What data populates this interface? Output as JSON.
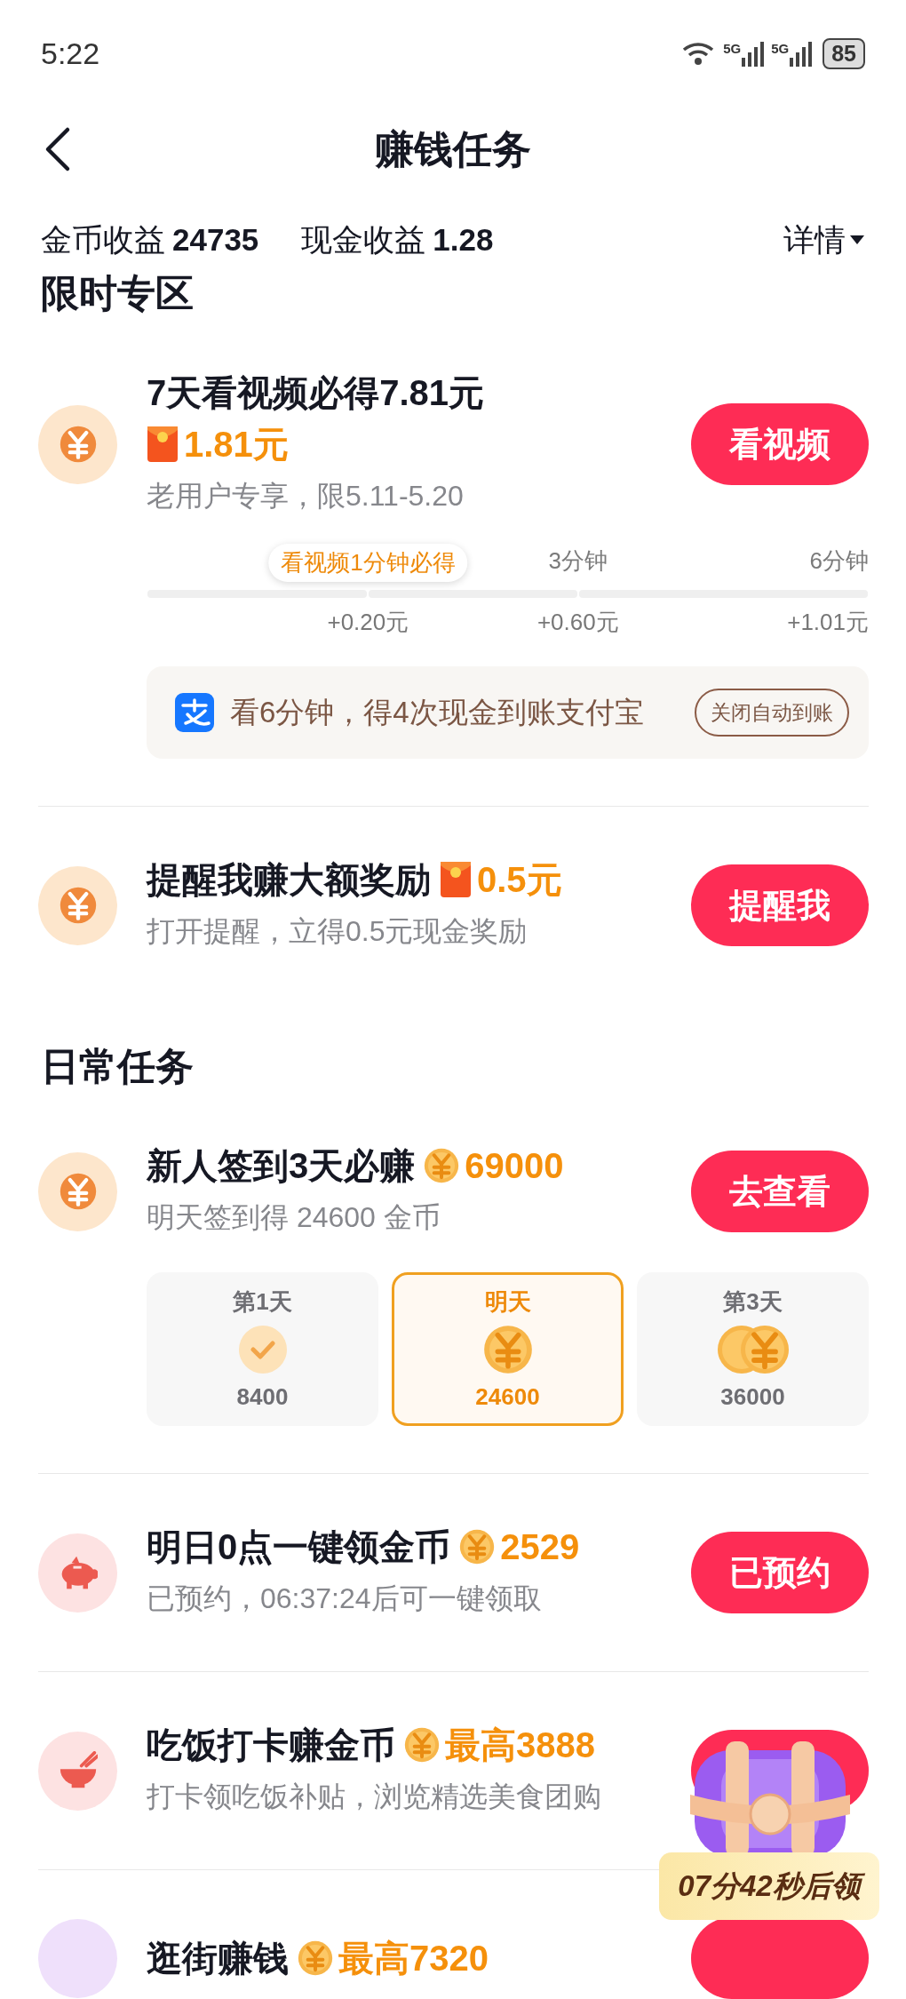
{
  "status_bar": {
    "time": "5:22",
    "network_1": "5G",
    "network_2": "5G",
    "battery": "85"
  },
  "header": {
    "title": "赚钱任务"
  },
  "stats": {
    "coin_label": "金币收益",
    "coin_value": "24735",
    "cash_label": "现金收益",
    "cash_value": "1.28",
    "details": "详情"
  },
  "sections": [
    {
      "title": "限时专区",
      "tasks": [
        {
          "kind": "yen",
          "title": "7天看视频必得7.81元",
          "reward": {
            "kind": "packet",
            "text": "1.81元"
          },
          "subtitle": "老用户专享，限5.11-5.20",
          "button": "看视频",
          "progress": [
            {
              "label": "看视频1分钟必得",
              "amount": "+0.20元",
              "highlighted": true
            },
            {
              "label": "3分钟",
              "amount": "+0.60元",
              "highlighted": false
            },
            {
              "label": "6分钟",
              "amount": "+1.01元",
              "highlighted": false
            }
          ],
          "notice": {
            "text": "看6分钟，得4次现金到账支付宝",
            "button": "关闭自动到账"
          }
        },
        {
          "kind": "yen",
          "title": "提醒我赚大额奖励",
          "reward": {
            "kind": "packet",
            "text": "0.5元"
          },
          "subtitle": "打开提醒，立得0.5元现金奖励",
          "button": "提醒我"
        }
      ]
    },
    {
      "title": "日常任务",
      "tasks": [
        {
          "kind": "yen",
          "title": "新人签到3天必赚",
          "reward": {
            "kind": "coin",
            "text": "69000"
          },
          "subtitle": "明天签到得 24600 金币",
          "button": "去查看",
          "days": [
            {
              "label": "第1天",
              "kind": "check",
              "amount": "8400",
              "selected": false
            },
            {
              "label": "明天",
              "kind": "coin",
              "amount": "24600",
              "selected": true
            },
            {
              "label": "第3天",
              "kind": "coins",
              "amount": "36000",
              "selected": false
            }
          ]
        },
        {
          "kind": "piggy",
          "title": "明日0点一键领金币",
          "reward": {
            "kind": "coin",
            "text": "2529"
          },
          "subtitle": "已预约，06:37:24后可一键领取",
          "button": "已预约"
        },
        {
          "kind": "bowl",
          "title": "吃饭打卡赚金币",
          "reward": {
            "kind": "coin",
            "text": "最高3888"
          },
          "subtitle": "打卡领吃饭补贴，浏览精选美食团购"
        },
        {
          "kind": "blank",
          "title": "逛街赚钱",
          "reward": {
            "kind": "coin",
            "text": "最高7320"
          }
        }
      ]
    }
  ],
  "floating_chest": {
    "timer": "07分42秒后领"
  }
}
